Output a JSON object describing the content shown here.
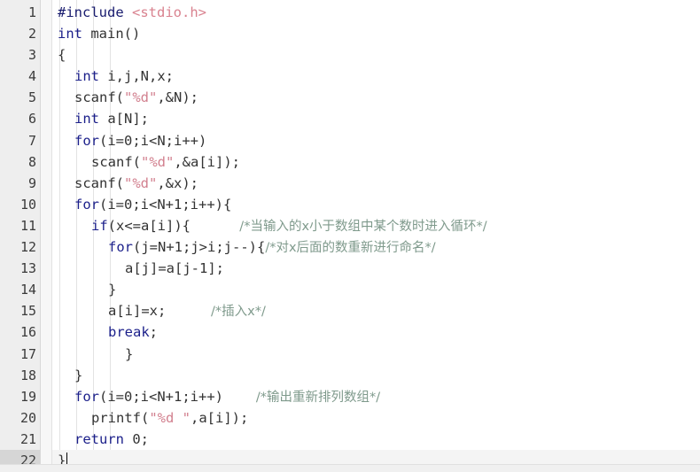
{
  "editor": {
    "language": "C",
    "total_lines": 22,
    "current_line": 22,
    "colors": {
      "background": "#ffffff",
      "gutter_background": "#eeeeee",
      "gutter_text": "#3b3b3b",
      "current_line_gutter": "#d6d6d6",
      "keyword": "#1b1f8a",
      "preprocessor": "#181b6e",
      "include_header": "#d9828f",
      "string": "#d2808f",
      "comment": "#7f9a8c",
      "plain_text": "#333333",
      "indent_guide": "#e3e3e3"
    },
    "lines": [
      {
        "number": "1",
        "fold": false,
        "indent": 0,
        "tokens": [
          {
            "cls": "pre",
            "text": "#include "
          },
          {
            "cls": "inc",
            "text": "<stdio.h>"
          }
        ]
      },
      {
        "number": "2",
        "fold": false,
        "indent": 0,
        "tokens": [
          {
            "cls": "kw",
            "text": "int"
          },
          {
            "cls": "pl",
            "text": " main()"
          }
        ]
      },
      {
        "number": "3",
        "fold": true,
        "indent": 0,
        "tokens": [
          {
            "cls": "pl",
            "text": "{"
          }
        ]
      },
      {
        "number": "4",
        "fold": false,
        "indent": 1,
        "tokens": [
          {
            "cls": "kw",
            "text": "int"
          },
          {
            "cls": "pl",
            "text": " i,j,N,x;"
          }
        ]
      },
      {
        "number": "5",
        "fold": false,
        "indent": 1,
        "tokens": [
          {
            "cls": "pl",
            "text": "scanf("
          },
          {
            "cls": "str",
            "text": "\"%d\""
          },
          {
            "cls": "pl",
            "text": ",&N);"
          }
        ]
      },
      {
        "number": "6",
        "fold": false,
        "indent": 1,
        "tokens": [
          {
            "cls": "kw",
            "text": "int"
          },
          {
            "cls": "pl",
            "text": " a[N];"
          }
        ]
      },
      {
        "number": "7",
        "fold": false,
        "indent": 1,
        "tokens": [
          {
            "cls": "kw",
            "text": "for"
          },
          {
            "cls": "pl",
            "text": "(i=0;i<N;i++)"
          }
        ]
      },
      {
        "number": "8",
        "fold": false,
        "indent": 2,
        "tokens": [
          {
            "cls": "pl",
            "text": "scanf("
          },
          {
            "cls": "str",
            "text": "\"%d\""
          },
          {
            "cls": "pl",
            "text": ",&a[i]);"
          }
        ]
      },
      {
        "number": "9",
        "fold": false,
        "indent": 1,
        "tokens": [
          {
            "cls": "pl",
            "text": "scanf("
          },
          {
            "cls": "str",
            "text": "\"%d\""
          },
          {
            "cls": "pl",
            "text": ",&x);"
          }
        ]
      },
      {
        "number": "10",
        "fold": true,
        "indent": 1,
        "tokens": [
          {
            "cls": "kw",
            "text": "for"
          },
          {
            "cls": "pl",
            "text": "(i=0;i<N+1;i++){"
          }
        ]
      },
      {
        "number": "11",
        "fold": true,
        "indent": 2,
        "tokens": [
          {
            "cls": "kw",
            "text": "if"
          },
          {
            "cls": "pl",
            "text": "(x<=a[i]){"
          },
          {
            "cls": "cm",
            "text": "            /*当输入的x小于数组中某个数时进入循环*/"
          }
        ]
      },
      {
        "number": "12",
        "fold": true,
        "indent": 3,
        "tokens": [
          {
            "cls": "kw",
            "text": "for"
          },
          {
            "cls": "pl",
            "text": "(j=N+1;j>i;j--){"
          },
          {
            "cls": "cm",
            "text": "/*对x后面的数重新进行命名*/"
          }
        ]
      },
      {
        "number": "13",
        "fold": false,
        "indent": 4,
        "tokens": [
          {
            "cls": "pl",
            "text": "a[j]=a[j-1];"
          }
        ]
      },
      {
        "number": "14",
        "fold": false,
        "indent": 3,
        "tokens": [
          {
            "cls": "pl",
            "text": "}"
          }
        ]
      },
      {
        "number": "15",
        "fold": false,
        "indent": 3,
        "tokens": [
          {
            "cls": "pl",
            "text": "a[i]=x;"
          },
          {
            "cls": "cm",
            "text": "           /*插入x*/"
          }
        ]
      },
      {
        "number": "16",
        "fold": false,
        "indent": 3,
        "tokens": [
          {
            "cls": "kw",
            "text": "break"
          },
          {
            "cls": "pl",
            "text": ";"
          }
        ]
      },
      {
        "number": "17",
        "fold": false,
        "indent": 4,
        "tokens": [
          {
            "cls": "pl",
            "text": "}"
          }
        ]
      },
      {
        "number": "18",
        "fold": false,
        "indent": 1,
        "tokens": [
          {
            "cls": "pl",
            "text": "}"
          }
        ]
      },
      {
        "number": "19",
        "fold": false,
        "indent": 1,
        "tokens": [
          {
            "cls": "kw",
            "text": "for"
          },
          {
            "cls": "pl",
            "text": "(i=0;i<N+1;i++)"
          },
          {
            "cls": "cm",
            "text": "        /*输出重新排列数组*/"
          }
        ]
      },
      {
        "number": "20",
        "fold": false,
        "indent": 2,
        "tokens": [
          {
            "cls": "pl",
            "text": "printf("
          },
          {
            "cls": "str",
            "text": "\"%d \""
          },
          {
            "cls": "pl",
            "text": ",a[i]);"
          }
        ]
      },
      {
        "number": "21",
        "fold": false,
        "indent": 1,
        "tokens": [
          {
            "cls": "kw",
            "text": "return"
          },
          {
            "cls": "pl",
            "text": " 0;"
          }
        ]
      },
      {
        "number": "22",
        "fold": false,
        "indent": 0,
        "caret": true,
        "tokens": [
          {
            "cls": "pl",
            "text": "}"
          }
        ]
      }
    ]
  }
}
